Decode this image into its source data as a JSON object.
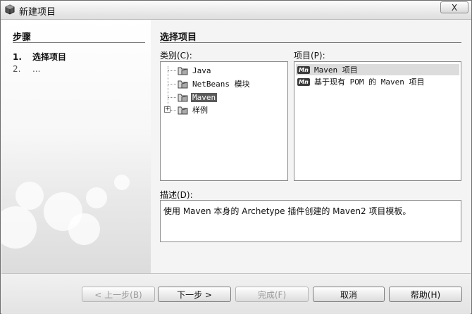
{
  "window": {
    "title": "新建项目",
    "close_label": "X"
  },
  "steps": {
    "title": "步骤",
    "items": [
      {
        "num": "1.",
        "label": "选择项目"
      },
      {
        "num": "2.",
        "label": "..."
      }
    ]
  },
  "main": {
    "section_title": "选择项目",
    "categories_label": "类别(C):",
    "projects_label": "项目(P):",
    "description_label": "描述(D):",
    "categories": [
      {
        "label": "Java"
      },
      {
        "label": "NetBeans 模块"
      },
      {
        "label": "Maven"
      },
      {
        "label": "样例"
      }
    ],
    "projects": [
      {
        "icon": "Mn",
        "label": "Maven 项目"
      },
      {
        "icon": "Mn",
        "label": "基于现有 POM 的 Maven 项目"
      }
    ],
    "description": "使用 Maven 本身的 Archetype 插件创建的 Maven2 项目模板。"
  },
  "buttons": {
    "back": "< 上一步(B)",
    "next": "下一步 >",
    "finish": "完成(F)",
    "cancel": "取消",
    "help": "帮助(H)"
  }
}
